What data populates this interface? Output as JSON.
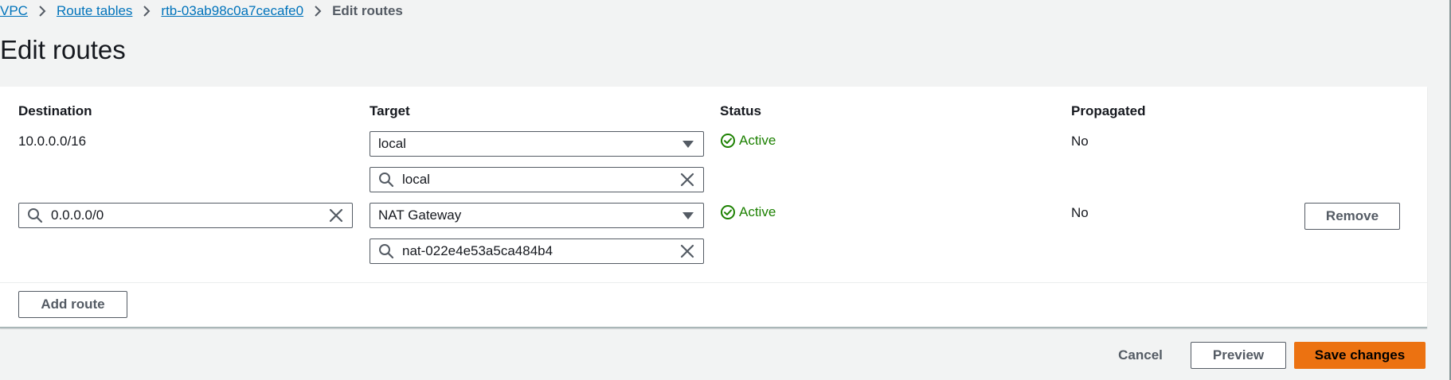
{
  "breadcrumb": {
    "items": [
      "VPC",
      "Route tables",
      "rtb-03ab98c0a7cecafe0"
    ],
    "current": "Edit routes"
  },
  "page": {
    "title": "Edit routes"
  },
  "table": {
    "headers": {
      "destination": "Destination",
      "target": "Target",
      "status": "Status",
      "propagated": "Propagated"
    },
    "rows": [
      {
        "destination": "10.0.0.0/16",
        "target_type": "local",
        "target_value": "local",
        "status": "Active",
        "propagated": "No"
      },
      {
        "destination": "0.0.0.0/0",
        "target_type": "NAT Gateway",
        "target_value": "nat-022e4e53a5ca484b4",
        "status": "Active",
        "propagated": "No",
        "remove_label": "Remove"
      }
    ]
  },
  "actions": {
    "add_route": "Add route",
    "cancel": "Cancel",
    "preview": "Preview",
    "save": "Save changes"
  },
  "colors": {
    "link": "#0073bb",
    "status_active": "#1d8102",
    "primary": "#ec7211"
  },
  "icons": {
    "separator": "chevron-right-icon",
    "search": "search-icon",
    "clear": "close-icon",
    "caret": "caret-down-icon",
    "status": "check-circle-icon"
  }
}
